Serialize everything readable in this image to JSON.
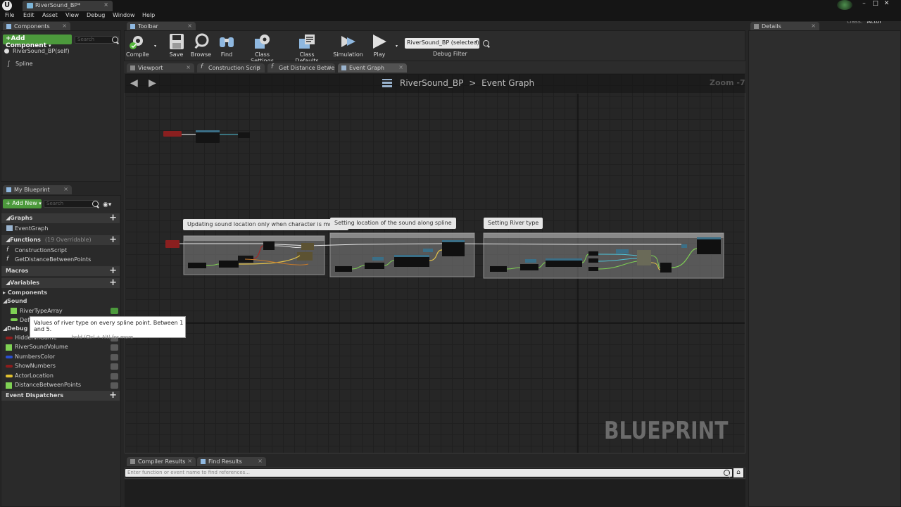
{
  "window": {
    "doc_tab": "RiverSound_BP*",
    "parent_class_label": "Parent class:",
    "parent_class_value": "Actor"
  },
  "menu": [
    "File",
    "Edit",
    "Asset",
    "View",
    "Debug",
    "Window",
    "Help"
  ],
  "components": {
    "tab_label": "Components",
    "add_button": "+Add Component",
    "search_placeholder": "Search",
    "items": [
      "RiverSound_BP(self)",
      "Spline"
    ]
  },
  "my_blueprint": {
    "tab_label": "My Blueprint",
    "add_button": "Add New",
    "search_placeholder": "Search",
    "sections": {
      "graphs": "Graphs",
      "functions": "Functions",
      "functions_sub": "(19 Overridable)",
      "macros": "Macros",
      "variables": "Variables",
      "event_dispatchers": "Event Dispatchers"
    },
    "graphs": [
      "EventGraph"
    ],
    "functions": [
      "ConstructionScript",
      "GetDistanceBetweenPoints"
    ],
    "var_categories": [
      "Components",
      "Sound",
      "Debug"
    ],
    "sound_vars": [
      "RiverTypeArray",
      "Def"
    ],
    "debug_vars": [
      "HiddenInGame",
      "RiverSoundVolume",
      "NumbersColor",
      "ShowNumbers",
      "ActorLocation",
      "DistanceBetweenPoints"
    ],
    "debug_var_colors": [
      "#8c1c1c",
      "#7fd154",
      "#2a4fd0",
      "#8c1c1c",
      "#e0c030",
      "#7fd154"
    ]
  },
  "toolbar": {
    "tab_label": "Toolbar",
    "buttons": [
      "Compile",
      "Save",
      "Browse",
      "Find",
      "Class Settings",
      "Class Defaults",
      "Simulation",
      "Play"
    ],
    "debug_select": "RiverSound_BP (selected)",
    "debug_filter_label": "Debug Filter"
  },
  "graph_tabs": [
    "Viewport",
    "Construction Scrip",
    "Get Distance Betwe",
    "Event Graph"
  ],
  "graph": {
    "breadcrumb_bp": "RiverSound_BP",
    "breadcrumb_sep": ">",
    "breadcrumb_graph": "Event Graph",
    "zoom": "Zoom -7",
    "watermark": "BLUEPRINT",
    "comments": [
      "Updating sound location only when character is moving",
      "Setting location of the sound along spline",
      "Setting River type"
    ]
  },
  "details": {
    "tab_label": "Details"
  },
  "bottom": {
    "tabs": [
      "Compiler Results",
      "Find Results"
    ],
    "find_placeholder": "Enter function or event name to find references..."
  },
  "tooltip": {
    "text": "Values of river type on every spline point. Between 1 and 5.",
    "hint": "hold (Ctrl + Alt) for more"
  },
  "colors": {
    "accent_green": "#4c9a3c",
    "exec_red": "#b02020",
    "wire_yellow": "#e3c34a",
    "wire_cyan": "#4fc3d8",
    "wire_green": "#7fd154"
  }
}
